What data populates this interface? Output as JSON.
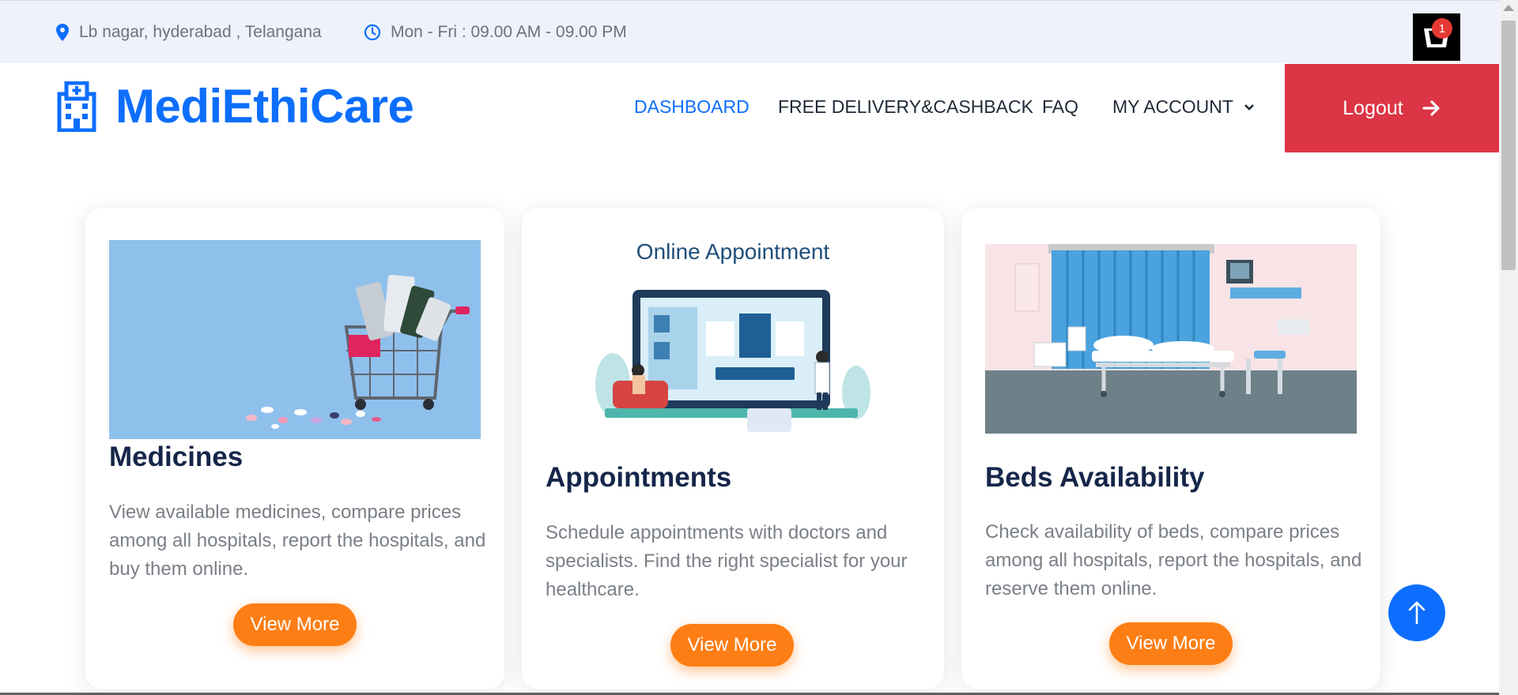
{
  "topbar": {
    "location": "Lb nagar, hyderabad , Telangana",
    "hours": "Mon - Fri : 09.00 AM - 09.00 PM",
    "cart_count": "1"
  },
  "brand": {
    "name": "MediEthiCare"
  },
  "nav": {
    "dashboard": "DASHBOARD",
    "delivery": "FREE DELIVERY&CASHBACK",
    "faq": "FAQ",
    "account": "MY ACCOUNT",
    "logout": "Logout"
  },
  "cards": [
    {
      "title": "Medicines",
      "description": "View available medicines, compare prices among all hospitals, report the hospitals, and buy them online.",
      "button": "View More"
    },
    {
      "title": "Appointments",
      "image_caption": "Online Appointment",
      "description": "Schedule appointments with doctors and specialists. Find the right specialist for your healthcare.",
      "button": "View More"
    },
    {
      "title": "Beds Availability",
      "description": "Check availability of beds, compare prices among all hospitals, report the hospitals, and reserve them online.",
      "button": "View More"
    }
  ],
  "colors": {
    "brand_blue": "#0d6efd",
    "logout_red": "#dc3545",
    "button_orange": "#fd7e14",
    "heading_navy": "#15264a"
  },
  "icons": [
    "location-pin-icon",
    "clock-icon",
    "cart-icon",
    "hospital-icon",
    "chevron-down-icon",
    "arrow-right-icon",
    "arrow-up-icon"
  ]
}
